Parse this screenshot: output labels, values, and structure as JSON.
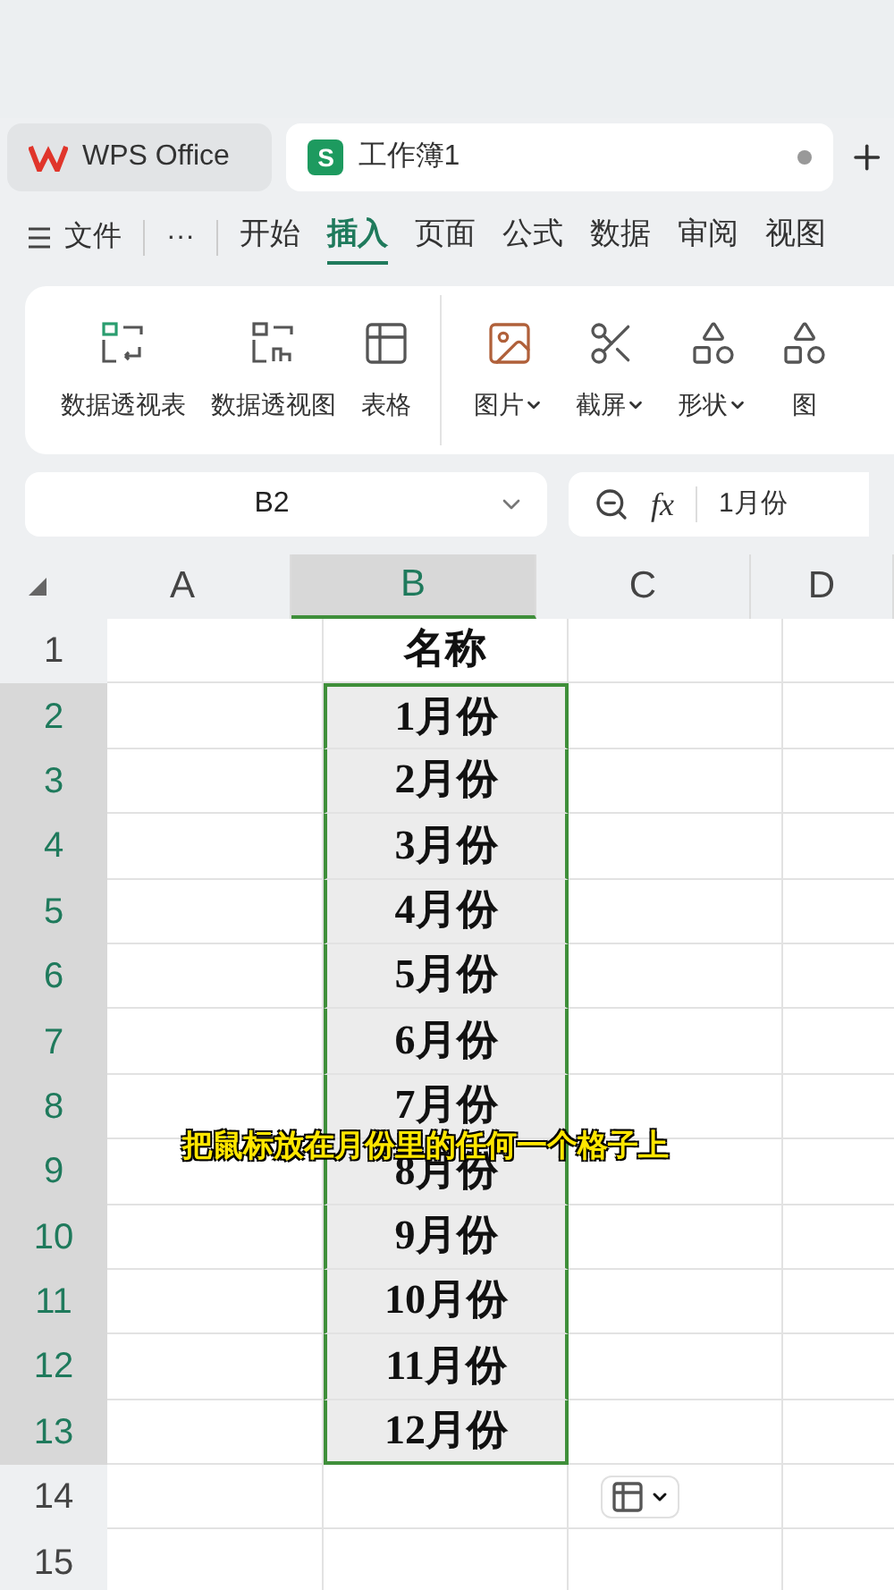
{
  "tabs": [
    {
      "label": "WPS Office",
      "selected": false
    },
    {
      "label": "工作簿1",
      "selected": true,
      "app_letter": "S"
    }
  ],
  "menu": {
    "file": "文件",
    "more": "···",
    "items": [
      {
        "label": "开始",
        "selected": false
      },
      {
        "label": "插入",
        "selected": true
      },
      {
        "label": "页面",
        "selected": false
      },
      {
        "label": "公式",
        "selected": false
      },
      {
        "label": "数据",
        "selected": false
      },
      {
        "label": "审阅",
        "selected": false
      },
      {
        "label": "视图",
        "selected": false
      }
    ]
  },
  "ribbon": [
    {
      "label": "数据透视表",
      "dropdown": false
    },
    {
      "label": "数据透视图",
      "dropdown": false
    },
    {
      "label": "表格",
      "dropdown": false
    },
    {
      "label": "图片",
      "dropdown": true
    },
    {
      "label": "截屏",
      "dropdown": true
    },
    {
      "label": "形状",
      "dropdown": true
    },
    {
      "label": "图",
      "dropdown": false
    }
  ],
  "formula_bar": {
    "name_box": "B2",
    "fx": "fx",
    "value": "1月份"
  },
  "columns": [
    {
      "label": "A",
      "selected": false
    },
    {
      "label": "B",
      "selected": true
    },
    {
      "label": "C",
      "selected": false
    },
    {
      "label": "D",
      "selected": false
    }
  ],
  "rows": [
    {
      "number": "1",
      "selected": false,
      "b": "名称"
    },
    {
      "number": "2",
      "selected": true,
      "b": "1月份"
    },
    {
      "number": "3",
      "selected": true,
      "b": "2月份"
    },
    {
      "number": "4",
      "selected": true,
      "b": "3月份"
    },
    {
      "number": "5",
      "selected": true,
      "b": "4月份"
    },
    {
      "number": "6",
      "selected": true,
      "b": "5月份"
    },
    {
      "number": "7",
      "selected": true,
      "b": "6月份"
    },
    {
      "number": "8",
      "selected": true,
      "b": "7月份"
    },
    {
      "number": "9",
      "selected": true,
      "b": "8月份"
    },
    {
      "number": "10",
      "selected": true,
      "b": "9月份"
    },
    {
      "number": "11",
      "selected": true,
      "b": "10月份"
    },
    {
      "number": "12",
      "selected": true,
      "b": "11月份"
    },
    {
      "number": "13",
      "selected": true,
      "b": "12月份"
    },
    {
      "number": "14",
      "selected": false
    },
    {
      "number": "15",
      "selected": false
    }
  ],
  "caption": "把鼠标放在月份里的任何一个格子上"
}
